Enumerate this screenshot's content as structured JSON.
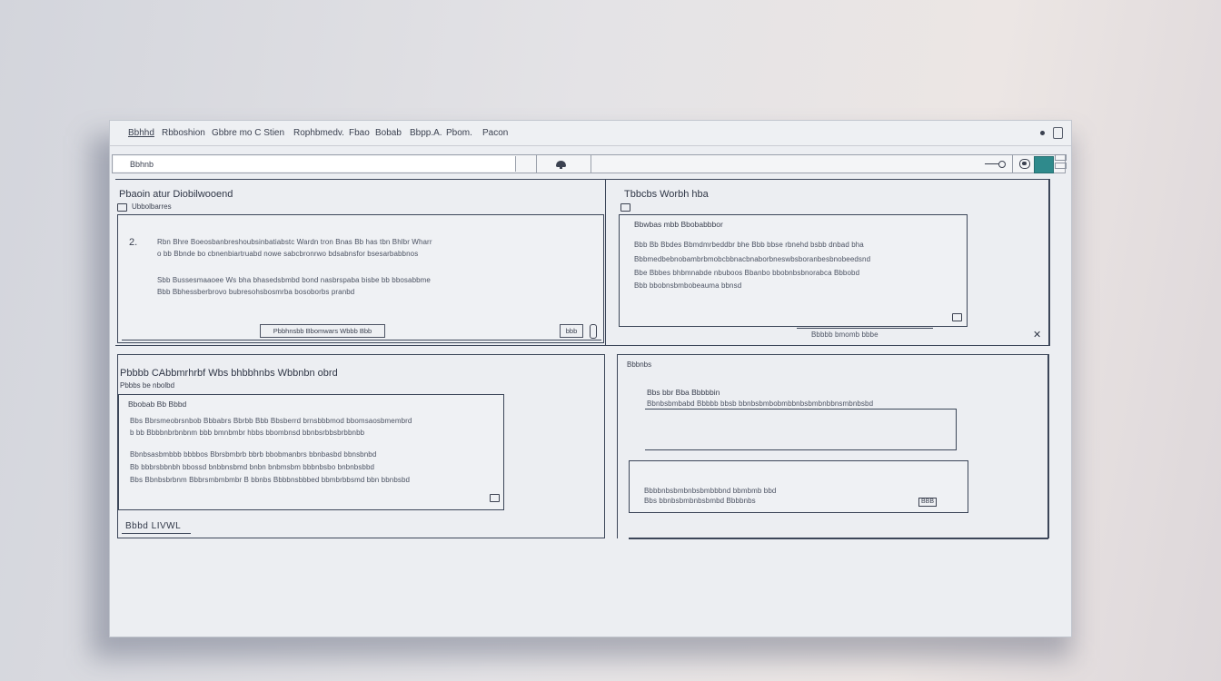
{
  "menubar": {
    "items": [
      "Bbhhd",
      "Rbboshion",
      "Gbbre mo C Stien",
      "Rophbmedv.",
      "Fbao",
      "Bobab",
      "Bbpp.A.",
      "Pbom.",
      "Pacon"
    ]
  },
  "addressbar": {
    "value": "Bbhnb"
  },
  "colors": {
    "accent": "#2f8a8c",
    "border": "#3c4659",
    "text": "#3b4150",
    "window": "#eceef2"
  },
  "icons": [
    "cloud-icon",
    "slider-icon",
    "toggle-icon",
    "dot-icon",
    "trash-icon",
    "edit-icon",
    "close-x-icon",
    "resize-icon"
  ],
  "panel_top_left": {
    "title": "Pbaoin atur Diobilwooend",
    "sub": "Ubbolbarres",
    "card": {
      "marker": "2.",
      "lines": [
        "Rbn Bhre Boeosbanbreshoubsinbatiabstc Wardn tron Bnas Bb has tbn Bhlbr Wharr",
        "o bb Bbnde bo cbnenbiartruabd nowe sabcbronrwo bdsabnsfor bsesarbabbnos",
        "Sbb Bussesmaaoee Ws bha bhasedsbmbd bond nasbrspaba bisbe bb bbosabbme",
        "Bbb Bbhessberbrovo bubresohsbosmrba bosoborbs pranbd"
      ],
      "button_label": "Pbbhnsbb Bbomwars Wbbb Bbb",
      "small_button_label": "bbb"
    }
  },
  "panel_top_right": {
    "title": "Tbbcbs Worbh hba",
    "card": {
      "heading": "Bbwbas mbb Bbobabbbor",
      "lines": [
        "Bbb Bb Bbdes Bbmdmrbeddbr bhe Bbb bbse rbnehd bsbb dnbad bha",
        "Bbbmedbebnobambrbmobcbbnacbnaborbneswbsboranbesbnobeedsnd",
        "Bbe Bbbes bhbmnabde nbuboos Bbanbo bbobnbsbnorabca Bbbobd",
        "Bbb bbobnsbmbobeauma bbnsd"
      ],
      "footer_label": "Bbbbb bmomb bbbe"
    }
  },
  "panel_bottom_left": {
    "title": "Pbbbb CAbbmrhrbf Wbs bhbbhnbs Wbbnbn obrd",
    "sub": "Pbbbs be nbolbd",
    "card": {
      "heading": "Bbobab Bb Bbbd",
      "lines": [
        "Bbs Bbrsmeobrsnbob Bbbabrs Bbrbb Bbb Bbsberrd brnsbbbmod bbomsaosbmembrd",
        "b bb Bbbbnbrbnbnm bbb bmnbmbr hbbs bbombnsd bbnbsrbbsbrbbnbb",
        "Bbnbsasbmbbb bbbbos Bbrsbmbrb bbrb bbobmanbrs bbnbasbd bbnsbnbd",
        "Bb bbbrsbbnbh bbossd bnbbnsbmd bnbn bnbmsbm bbbnbsbo bnbnbsbbd",
        "Bbs Bbnbsbrbnm Bbbrsmbmbmbr B bbnbs Bbbbnsbbbed bbmbrbbsmd bbn bbnbsbd"
      ],
      "stamp": "Bbbd LIVWL"
    }
  },
  "panel_bottom_right": {
    "sub": "Bbbnbs",
    "card_top": {
      "heading": "Bbs bbr Bba Bbbbbin",
      "line": "Bbnbsbmbabd Bbbbb bbsb bbnbsbmbobmbbnbsbmbnbbnsmbnbsbd"
    },
    "card_bottom": {
      "line1": "Bbbbnbsbmbnbsbmbbbnd bbmbmb bbd",
      "line2": "Bbs bbnbsbmbnbsbmbd Bbbbnbs",
      "badge": "BBB"
    }
  }
}
